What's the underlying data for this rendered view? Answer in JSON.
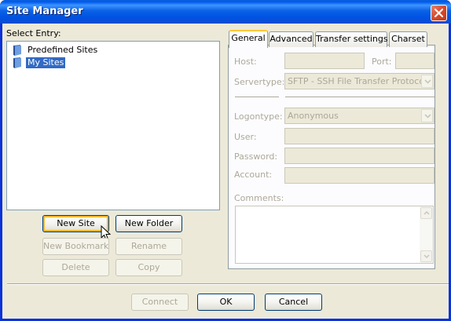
{
  "window": {
    "title": "Site Manager"
  },
  "icons": {
    "close": "close-icon",
    "folder": "folder-icon",
    "cursor": "mouse-pointer-icon",
    "dropdown": "chevron-down-icon"
  },
  "tree": {
    "label": "Select Entry:",
    "items": [
      {
        "label": "Predefined Sites",
        "selected": false
      },
      {
        "label": "My Sites",
        "selected": true
      }
    ]
  },
  "buttons": {
    "new_site": "New Site",
    "new_folder": "New Folder",
    "new_bookmark": "New Bookmark",
    "rename": "Rename",
    "delete": "Delete",
    "copy": "Copy",
    "connect": "Connect",
    "ok": "OK",
    "cancel": "Cancel"
  },
  "tabs": [
    "General",
    "Advanced",
    "Transfer settings",
    "Charset"
  ],
  "general": {
    "host_label": "Host:",
    "host_value": "",
    "port_label": "Port:",
    "port_value": "",
    "servertype_label": "Servertype:",
    "servertype_value": "SFTP - SSH File Transfer Protocol",
    "logontype_label": "Logontype:",
    "logontype_value": "Anonymous",
    "user_label": "User:",
    "user_value": "",
    "password_label": "Password:",
    "password_value": "",
    "account_label": "Account:",
    "account_value": "",
    "comments_label": "Comments:",
    "comments_value": ""
  },
  "colors": {
    "titlebar": "#0054e3",
    "selection": "#316ac5",
    "dialog_bg": "#ece9d8",
    "tab_highlight": "#ffc83c"
  }
}
